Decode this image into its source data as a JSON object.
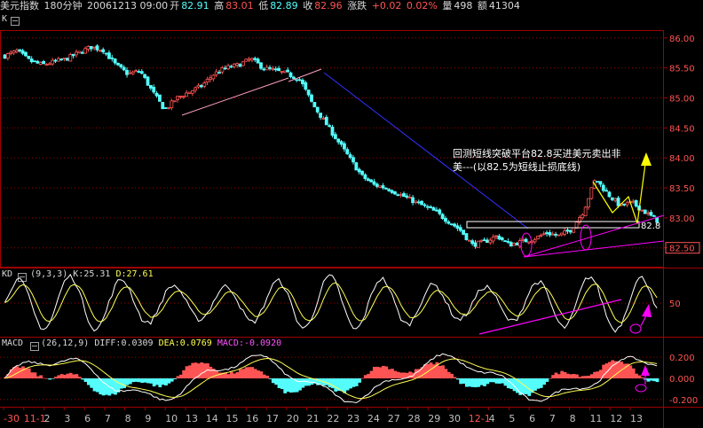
{
  "header": {
    "symbol": "美元指数",
    "period": "180分钟",
    "datetime": "20061213 09:00",
    "open_label": "开",
    "open": "82.91",
    "high_label": "高",
    "high": "83.01",
    "low_label": "低",
    "low": "82.89",
    "close_label": "收",
    "close": "82.96",
    "change_label": "涨跌",
    "change": "+0.02",
    "change_pct": "0.02%",
    "volume_label": "量",
    "volume": "498",
    "amount_label": "额",
    "amount": "41304"
  },
  "panels": {
    "main": {
      "label": "K",
      "annotation_line1": "回测短线突破平台82.8买进美元卖出非",
      "annotation_line2": "美---(以82.5为短线止损底线)",
      "level_label": "82.8",
      "y_ticks": [
        "86.00",
        "85.50",
        "85.00",
        "84.50",
        "84.00",
        "83.50",
        "83.00",
        "82.50"
      ]
    },
    "kd": {
      "label": "KD",
      "params": "(9,3,3)",
      "k_label": "K:",
      "k_value": "25.31",
      "d_label": "D:",
      "d_value": "27.61",
      "y_tick": "50"
    },
    "macd": {
      "label": "MACD",
      "params": "(26,12,9)",
      "diff_label": "DIFF:",
      "diff_value": "0.0309",
      "dea_label": "DEA:",
      "dea_value": "0.0769",
      "macd_label": "MACD:",
      "macd_value": "-0.0920",
      "y_ticks": [
        "0.200",
        "0.000",
        "-0.200"
      ]
    }
  },
  "x_axis": {
    "labels": [
      "-30",
      "11-1",
      "2",
      "3",
      "6",
      "7",
      "8",
      "9",
      "10",
      "13",
      "14",
      "15",
      "16",
      "17",
      "20",
      "21",
      "22",
      "23",
      "24",
      "27",
      "28",
      "29",
      "30",
      "12-1",
      "4",
      "5",
      "6",
      "7",
      "8",
      "11",
      "12",
      "13"
    ]
  },
  "colors": {
    "up": "#ff5454",
    "down": "#54fcfc",
    "k_line": "#ffffff",
    "d_line": "#ffff54",
    "trend_blue": "#3030ff",
    "trend_magenta": "#ff00ff",
    "trend_pink": "#ffa0c0",
    "arrow_yellow": "#ffff00",
    "grid_red": "#a00000"
  },
  "chart_data": [
    {
      "type": "candlestick",
      "title": "美元指数 180分钟",
      "ylim": [
        82.2,
        86.1
      ],
      "y_ticks": [
        86.0,
        85.5,
        85.0,
        84.5,
        84.0,
        83.5,
        83.0,
        82.5
      ],
      "x_categories": [
        "-30",
        "11-1",
        "2",
        "3",
        "6",
        "7",
        "8",
        "9",
        "10",
        "13",
        "14",
        "15",
        "16",
        "17",
        "20",
        "21",
        "22",
        "23",
        "24",
        "27",
        "28",
        "29",
        "30",
        "12-1",
        "4",
        "5",
        "6",
        "7",
        "8",
        "11",
        "12",
        "13"
      ],
      "close_path": [
        [
          0,
          85.7
        ],
        [
          1,
          85.78
        ],
        [
          2,
          85.62
        ],
        [
          3,
          85.55
        ],
        [
          4,
          85.6
        ],
        [
          5,
          85.65
        ],
        [
          6,
          85.75
        ],
        [
          7,
          85.85
        ],
        [
          8,
          85.8
        ],
        [
          9,
          85.55
        ],
        [
          10,
          85.4
        ],
        [
          11,
          85.45
        ],
        [
          12,
          85.1
        ],
        [
          13,
          84.8
        ],
        [
          14,
          85.0
        ],
        [
          15,
          85.1
        ],
        [
          16,
          85.2
        ],
        [
          17,
          85.4
        ],
        [
          18,
          85.5
        ],
        [
          19,
          85.55
        ],
        [
          20,
          85.65
        ],
        [
          21,
          85.5
        ],
        [
          22,
          85.45
        ],
        [
          23,
          85.4
        ],
        [
          24,
          85.3
        ],
        [
          25,
          84.9
        ],
        [
          26,
          84.6
        ],
        [
          27,
          84.3
        ],
        [
          28,
          84.0
        ],
        [
          29,
          83.7
        ],
        [
          30,
          83.55
        ],
        [
          31,
          83.5
        ],
        [
          32,
          83.4
        ],
        [
          33,
          83.3
        ],
        [
          34,
          83.2
        ],
        [
          35,
          83.1
        ],
        [
          36,
          82.95
        ],
        [
          37,
          82.8
        ],
        [
          38,
          82.55
        ],
        [
          39,
          82.6
        ],
        [
          40,
          82.7
        ],
        [
          41,
          82.55
        ],
        [
          42,
          82.6
        ],
        [
          43,
          82.65
        ],
        [
          44,
          82.75
        ],
        [
          45,
          82.7
        ],
        [
          46,
          82.8
        ],
        [
          47,
          83.1
        ],
        [
          48,
          83.65
        ],
        [
          49,
          83.4
        ],
        [
          50,
          83.2
        ],
        [
          51,
          83.25
        ],
        [
          52,
          83.1
        ],
        [
          53,
          82.96
        ]
      ],
      "annotations": [
        "回测短线突破平台82.8买进美元卖出非",
        "美---(以82.5为短线止损底线)",
        "82.8"
      ]
    },
    {
      "type": "line",
      "title": "KD (9,3,3)",
      "series": [
        {
          "name": "K",
          "last": 25.31
        },
        {
          "name": "D",
          "last": 27.61
        }
      ],
      "y_ticks": [
        50
      ]
    },
    {
      "type": "bar",
      "title": "MACD (26,12,9)",
      "series": [
        {
          "name": "DIFF",
          "last": 0.0309
        },
        {
          "name": "DEA",
          "last": 0.0769
        },
        {
          "name": "MACD",
          "last": -0.092
        }
      ],
      "y_ticks": [
        0.2,
        0.0,
        -0.2
      ]
    }
  ]
}
